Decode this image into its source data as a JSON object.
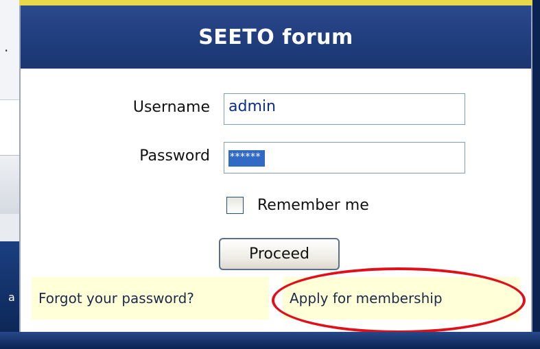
{
  "background": {
    "fragment_period": ".",
    "fragment_toolbar": "a",
    "fragment_taskbar": "a"
  },
  "login": {
    "title": "SEETO forum",
    "username_label": "Username",
    "username_value": "admin",
    "password_label": "Password",
    "password_masked": "******",
    "remember_label": "Remember me",
    "remember_checked": false,
    "proceed_label": "Proceed",
    "forgot_link": "Forgot your password?",
    "apply_link": "Apply for membership"
  },
  "colors": {
    "header": "#1f3c7c",
    "link_background": "#ffffd8",
    "annotation": "#e0101a",
    "selection": "#316ac5"
  }
}
